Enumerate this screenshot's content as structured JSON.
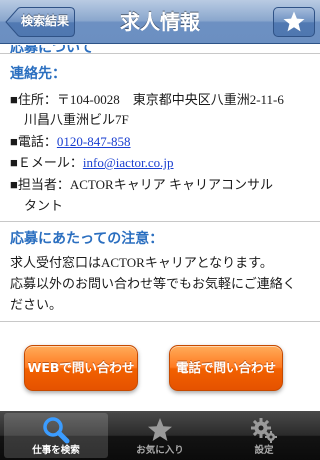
{
  "nav": {
    "back_label": "検索結果",
    "title": "求人情報",
    "favorite_icon": "star-icon"
  },
  "content": {
    "cut_header": "応募について",
    "contact": {
      "title": "連絡先：",
      "address_label": "住所：",
      "address_line1": "〒104-0028　東京都中央区八重洲2-11-6",
      "address_line2": "川昌八重洲ビル7F",
      "phone_label": "電話：",
      "phone": "0120-847-858",
      "email_label": "Ｅメール：",
      "email": "info@iactor.co.jp",
      "person_label": "担当者：",
      "person_line1": "ACTORキャリア キャリアコンサル",
      "person_line2": "タント"
    },
    "notice": {
      "title": "応募にあたっての注意：",
      "line1": "求人受付窓口はACTORキャリアとなります。",
      "line2": "応募以外のお問い合わせ等でもお気軽にご連絡く",
      "line3": "ださい。"
    },
    "buttons": {
      "web": "WEBで問い合わせ",
      "phone": "電話で問い合わせ"
    }
  },
  "tabbar": {
    "items": [
      {
        "label": "仕事を検索",
        "icon": "magnifier-icon",
        "active": true
      },
      {
        "label": "お気に入り",
        "icon": "star-icon",
        "active": false
      },
      {
        "label": "設定",
        "icon": "gear-icon",
        "active": false
      }
    ]
  },
  "colors": {
    "section_title": "#2b6fc0",
    "link": "#1a3fd0",
    "button_orange": "#f26100"
  }
}
